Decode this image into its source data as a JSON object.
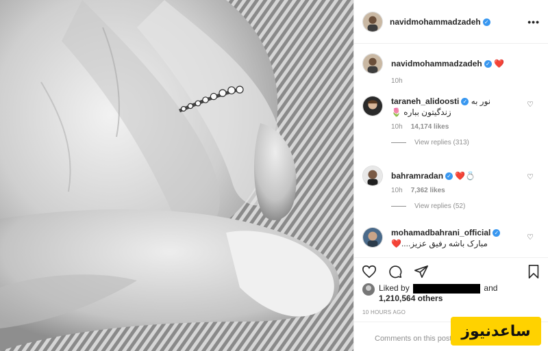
{
  "post": {
    "author": "navidmohammadzadeh",
    "more_icon": "more-options-icon"
  },
  "caption": {
    "username": "navidmohammadzadeh",
    "emoji": "❤️",
    "time": "10h"
  },
  "comments": [
    {
      "username": "taraneh_alidoosti",
      "text_line1": "نور به",
      "text_line2": "زندگیتون بباره 🌷",
      "time": "10h",
      "likes": "14,174 likes",
      "replies": "View replies (313)"
    },
    {
      "username": "bahramradan",
      "text_line1": "❤️💍",
      "text_line2": "",
      "time": "10h",
      "likes": "7,362 likes",
      "replies": "View replies (52)"
    },
    {
      "username": "mohamadbahrani_official",
      "text_line1": "",
      "text_line2": "مبارک باشه رفیق عزیز....❤️",
      "time": "",
      "likes": "",
      "replies": ""
    }
  ],
  "likes": {
    "prefix": "Liked by",
    "suffix": "and",
    "count": "1,210,564 others"
  },
  "timestamp": "10 HOURS AGO",
  "add_comment_placeholder": "Comments on this post",
  "watermark": "ساعدنیوز",
  "colors": {
    "verified": "#3897f0",
    "watermark_bg": "#FFD200",
    "heart": "#ed4956"
  }
}
